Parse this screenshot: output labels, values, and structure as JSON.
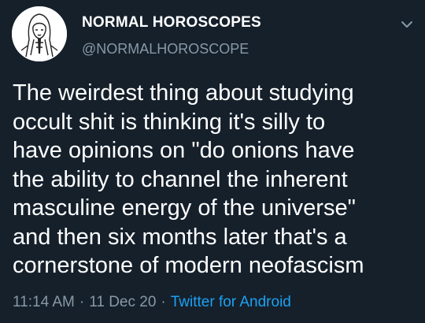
{
  "tweet": {
    "display_name": "NORMAL HOROSCOPES",
    "handle": "@NORMALHOROSCOPE",
    "text": "The weirdest thing about studying\noccult shit is thinking it's silly to\nhave opinions on \"do onions have\nthe ability to channel the inherent\nmasculine energy of the universe\"\nand then six months later that's a\ncornerstone of modern neofascism",
    "time": "11:14 AM",
    "date": "11 Dec 20",
    "separator": "·",
    "source": "Twitter for Android"
  },
  "icons": {
    "menu": "chevron-down-icon",
    "avatar": "avatar"
  },
  "colors": {
    "background": "#15202b",
    "text": "#ffffff",
    "secondary": "#8899a6",
    "link": "#1da1f2"
  }
}
